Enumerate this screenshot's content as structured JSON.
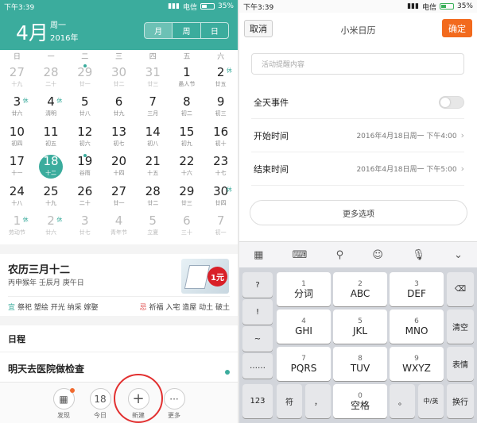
{
  "left": {
    "status": {
      "time": "下午3:39",
      "carrier": "电信",
      "battery": "35%",
      "battery_level": 0.35
    },
    "header": {
      "month": "4月",
      "weekday": "周一",
      "year": "2016年",
      "views": [
        "月",
        "周",
        "日"
      ],
      "active_view": "月"
    },
    "weekdays": [
      "日",
      "一",
      "二",
      "三",
      "四",
      "五",
      "六"
    ],
    "days": [
      {
        "n": "27",
        "s": "十九",
        "dim": true
      },
      {
        "n": "28",
        "s": "二十",
        "dim": true
      },
      {
        "n": "29",
        "s": "廿一",
        "dim": true,
        "dot": true
      },
      {
        "n": "30",
        "s": "廿二",
        "dim": true
      },
      {
        "n": "31",
        "s": "廿三",
        "dim": true
      },
      {
        "n": "1",
        "s": "愚人节"
      },
      {
        "n": "2",
        "s": "廿五",
        "hol": "休"
      },
      {
        "n": "3",
        "s": "廿六",
        "hol": "休"
      },
      {
        "n": "4",
        "s": "清明",
        "hol": "休"
      },
      {
        "n": "5",
        "s": "廿八"
      },
      {
        "n": "6",
        "s": "廿九"
      },
      {
        "n": "7",
        "s": "三月"
      },
      {
        "n": "8",
        "s": "初二"
      },
      {
        "n": "9",
        "s": "初三"
      },
      {
        "n": "10",
        "s": "初四"
      },
      {
        "n": "11",
        "s": "初五"
      },
      {
        "n": "12",
        "s": "初六"
      },
      {
        "n": "13",
        "s": "初七"
      },
      {
        "n": "14",
        "s": "初八"
      },
      {
        "n": "15",
        "s": "初九"
      },
      {
        "n": "16",
        "s": "初十"
      },
      {
        "n": "17",
        "s": "十一"
      },
      {
        "n": "18",
        "s": "十二",
        "sel": true
      },
      {
        "n": "19",
        "s": "谷雨",
        "dot": true
      },
      {
        "n": "20",
        "s": "十四"
      },
      {
        "n": "21",
        "s": "十五"
      },
      {
        "n": "22",
        "s": "十六"
      },
      {
        "n": "23",
        "s": "十七"
      },
      {
        "n": "24",
        "s": "十八"
      },
      {
        "n": "25",
        "s": "十九"
      },
      {
        "n": "26",
        "s": "二十"
      },
      {
        "n": "27",
        "s": "廿一"
      },
      {
        "n": "28",
        "s": "廿二"
      },
      {
        "n": "29",
        "s": "廿三"
      },
      {
        "n": "30",
        "s": "廿四",
        "hol": "休"
      },
      {
        "n": "1",
        "s": "劳动节",
        "dim": true,
        "hol": "休"
      },
      {
        "n": "2",
        "s": "廿六",
        "dim": true,
        "hol": "休"
      },
      {
        "n": "3",
        "s": "廿七",
        "dim": true
      },
      {
        "n": "4",
        "s": "青年节",
        "dim": true
      },
      {
        "n": "5",
        "s": "立夏",
        "dim": true
      },
      {
        "n": "6",
        "s": "三十",
        "dim": true
      },
      {
        "n": "7",
        "s": "初一",
        "dim": true
      }
    ],
    "almanac": {
      "lunar": "农历三月十二",
      "ganzhi": "丙申猴年 壬辰月 庚午日",
      "yi_icon": "宜",
      "yi": "祭祀 塑绘 开光 纳采 嫁娶",
      "ji_icon": "忌",
      "ji": "祈福 入宅 造屋 动土 破土",
      "ad_badge": "1元"
    },
    "schedule": {
      "title": "日程",
      "event": "明天去医院做检查"
    },
    "bottom": [
      {
        "label": "发现",
        "icon": "grid-icon",
        "glyph": "▦",
        "dot": true
      },
      {
        "label": "今日",
        "icon": "today-icon",
        "glyph": "18"
      },
      {
        "label": "新建",
        "icon": "plus-icon",
        "glyph": "+"
      },
      {
        "label": "更多",
        "icon": "more-icon",
        "glyph": "···"
      }
    ]
  },
  "right": {
    "status": {
      "time": "下午3:39",
      "carrier": "电信",
      "battery": "35%",
      "battery_level": 0.35
    },
    "header": {
      "cancel": "取消",
      "title": "小米日历",
      "ok": "确定"
    },
    "remind_placeholder": "活动提醒内容",
    "allday": "全天事件",
    "start": {
      "label": "开始时间",
      "value": "2016年4月18日周一 下午4:00"
    },
    "end": {
      "label": "结束时间",
      "value": "2016年4月18日周一 下午5:00"
    },
    "more": "更多选项",
    "toolbar": [
      "▦",
      "⌨",
      "⚲",
      "☺",
      "🎙",
      "⌄"
    ],
    "keys": {
      "q": "?",
      "ex": "!",
      "tilde": "~",
      "dots": "……",
      "k1": {
        "n": "1",
        "l": "分词"
      },
      "k2": {
        "n": "2",
        "l": "ABC"
      },
      "k3": {
        "n": "3",
        "l": "DEF"
      },
      "k4": {
        "n": "4",
        "l": "GHI"
      },
      "k5": {
        "n": "5",
        "l": "JKL"
      },
      "k6": {
        "n": "6",
        "l": "MNO"
      },
      "k7": {
        "n": "7",
        "l": "PQRS"
      },
      "k8": {
        "n": "8",
        "l": "TUV"
      },
      "k9": {
        "n": "9",
        "l": "WXYZ"
      },
      "k0": {
        "n": "0",
        "l": "空格"
      },
      "del": "⌫",
      "clear": "清空",
      "emoji": "表情",
      "num": "123",
      "sym": "符",
      "comma": "，",
      "period": "。",
      "lang": "中/英",
      "enter": "换行"
    }
  }
}
